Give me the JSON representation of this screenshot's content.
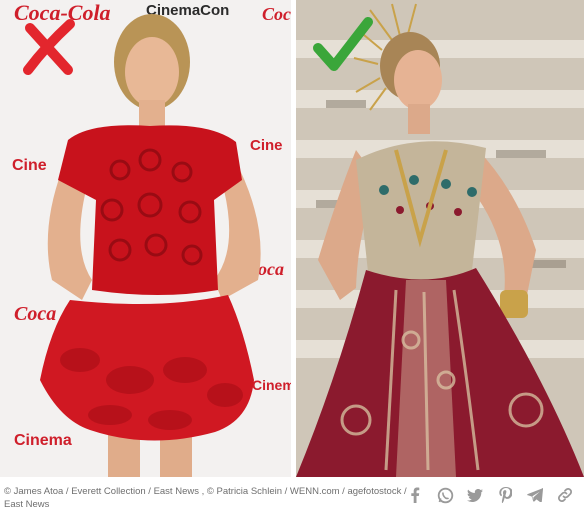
{
  "comparison": {
    "left_verdict_icon": "red-cross-icon",
    "right_verdict_icon": "green-checkmark-icon",
    "left_watermarks": [
      "Coca-Cola",
      "CinemaCon",
      "Cinema",
      "Coca-Cola",
      "Cinema"
    ],
    "colors": {
      "cross": "#e3262d",
      "check": "#3aa63a",
      "red_dress": "#c8121c",
      "gown_burgundy": "#8b1a2e",
      "gold": "#c9a24a"
    }
  },
  "footer": {
    "credit_line1": "© James Atoa / Everett Collection / East News , © Patricia Schlein / WENN.com / agefotostock /",
    "credit_line2": "East News",
    "share_icons": [
      "facebook-icon",
      "whatsapp-icon",
      "twitter-icon",
      "pinterest-icon",
      "telegram-icon",
      "link-icon"
    ]
  }
}
